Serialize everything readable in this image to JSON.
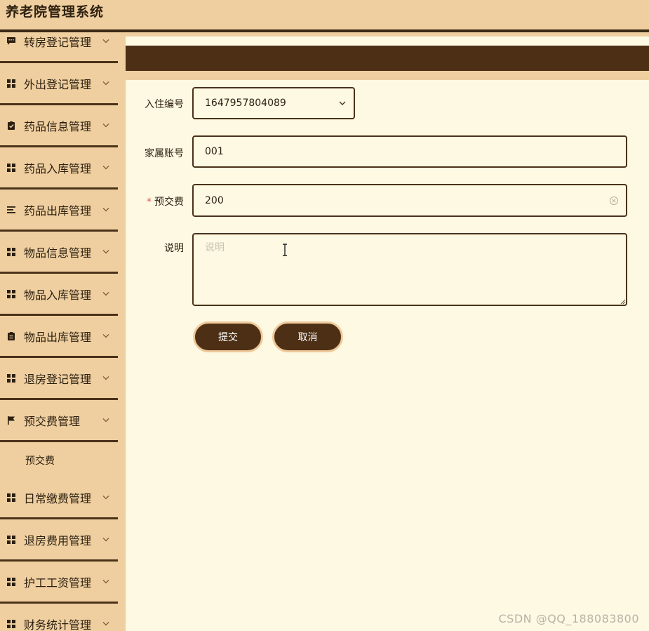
{
  "app": {
    "title": "养老院管理系统"
  },
  "sidebar": {
    "items": [
      {
        "label": "转房登记管理",
        "icon": "comment-icon"
      },
      {
        "label": "外出登记管理",
        "icon": "grid-icon"
      },
      {
        "label": "药品信息管理",
        "icon": "clipboard-check-icon"
      },
      {
        "label": "药品入库管理",
        "icon": "grid-icon"
      },
      {
        "label": "药品出库管理",
        "icon": "list-icon"
      },
      {
        "label": "物品信息管理",
        "icon": "grid-icon"
      },
      {
        "label": "物品入库管理",
        "icon": "grid-icon"
      },
      {
        "label": "物品出库管理",
        "icon": "clipboard-icon"
      },
      {
        "label": "退房登记管理",
        "icon": "grid-icon"
      },
      {
        "label": "预交费管理",
        "icon": "flag-icon"
      },
      {
        "label": "日常缴费管理",
        "icon": "grid-icon"
      },
      {
        "label": "退房费用管理",
        "icon": "grid-icon"
      },
      {
        "label": "护工工资管理",
        "icon": "grid-icon"
      },
      {
        "label": "财务统计管理",
        "icon": "grid-icon"
      }
    ],
    "sub_item": {
      "label": "预交费"
    }
  },
  "form": {
    "checkin_no": {
      "label": "入住编号",
      "value": "1647957804089"
    },
    "family_account": {
      "label": "家属账号",
      "value": "001"
    },
    "prepay": {
      "label": "预交费",
      "required_mark": "*",
      "value": "200"
    },
    "remark": {
      "label": "说明",
      "placeholder": "说明"
    },
    "submit_label": "提交",
    "cancel_label": "取消"
  },
  "watermark": "CSDN @QQ_188083800",
  "colors": {
    "header_bg": "#efcfa0",
    "dark_brown": "#4c2f14",
    "content_bg": "#fdf9e3",
    "required": "#e5534b"
  }
}
